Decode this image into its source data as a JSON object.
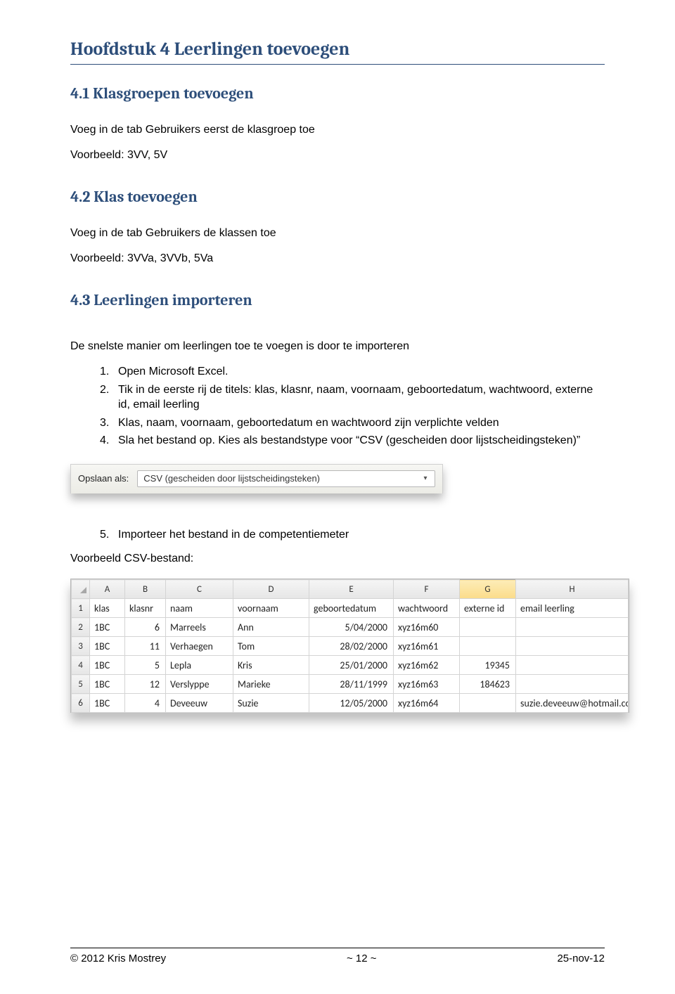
{
  "chapter_title": "Hoofdstuk 4 Leerlingen toevoegen",
  "sections": {
    "s41": {
      "title": "4.1 Klasgroepen toevoegen",
      "p1": "Voeg in de tab Gebruikers eerst de klasgroep toe",
      "p2": "Voorbeeld: 3VV, 5V"
    },
    "s42": {
      "title": "4.2 Klas toevoegen",
      "p1": "Voeg in de tab Gebruikers de klassen toe",
      "p2": "Voorbeeld: 3VVa, 3VVb, 5Va"
    },
    "s43": {
      "title": "4.3 Leerlingen importeren",
      "intro": "De snelste manier om leerlingen toe te voegen is door te importeren",
      "steps": [
        "Open Microsoft Excel.",
        "Tik in de eerste rij de titels: klas, klasnr, naam, voornaam, geboortedatum, wachtwoord, externe id, email leerling",
        "Klas, naam, voornaam, geboortedatum en wachtwoord zijn verplichte velden",
        "Sla het bestand op. Kies als bestandstype voor “CSV (gescheiden door lijstscheidingsteken)”"
      ],
      "step5": "Importeer het bestand in de competentiemeter",
      "example_label": "Voorbeeld CSV-bestand:"
    }
  },
  "save_as": {
    "label": "Opslaan als:",
    "value": "CSV (gescheiden door lijstscheidingsteken)"
  },
  "excel": {
    "columns": [
      "A",
      "B",
      "C",
      "D",
      "E",
      "F",
      "G",
      "H"
    ],
    "active_column_index": 6,
    "headers": [
      "klas",
      "klasnr",
      "naam",
      "voornaam",
      "geboortedatum",
      "wachtwoord",
      "externe id",
      "email leerling"
    ],
    "rows": [
      {
        "n": 2,
        "klas": "1BC",
        "klasnr": 6,
        "naam": "Marreels",
        "voornaam": "Ann",
        "geb": "5/04/2000",
        "ww": "xyz16m60",
        "ext": "",
        "email": ""
      },
      {
        "n": 3,
        "klas": "1BC",
        "klasnr": 11,
        "naam": "Verhaegen",
        "voornaam": "Tom",
        "geb": "28/02/2000",
        "ww": "xyz16m61",
        "ext": "",
        "email": ""
      },
      {
        "n": 4,
        "klas": "1BC",
        "klasnr": 5,
        "naam": "Lepla",
        "voornaam": "Kris",
        "geb": "25/01/2000",
        "ww": "xyz16m62",
        "ext": "19345",
        "email": ""
      },
      {
        "n": 5,
        "klas": "1BC",
        "klasnr": 12,
        "naam": "Verslyppe",
        "voornaam": "Marieke",
        "geb": "28/11/1999",
        "ww": "xyz16m63",
        "ext": "184623",
        "email": ""
      },
      {
        "n": 6,
        "klas": "1BC",
        "klasnr": 4,
        "naam": "Deveeuw",
        "voornaam": "Suzie",
        "geb": "12/05/2000",
        "ww": "xyz16m64",
        "ext": "",
        "email": "suzie.deveeuw@hotmail.com"
      }
    ]
  },
  "footer": {
    "left": "© 2012 Kris Mostrey",
    "center": "~ 12 ~",
    "right": "25-nov-12"
  }
}
